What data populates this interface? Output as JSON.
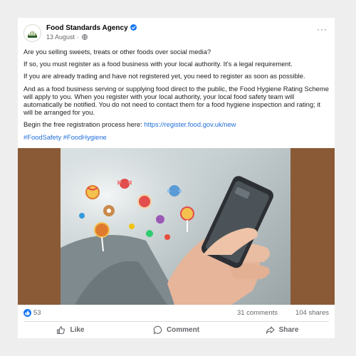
{
  "post": {
    "author": "Food Standards Agency",
    "date": "13 August",
    "separator": "·",
    "more": "···",
    "paragraphs": [
      "Are you selling sweets, treats or other foods over social media?",
      "If so, you must register as a food business with your local authority. It's a legal requirement.",
      "If you are already trading and have not registered yet, you need to register as soon as possible.",
      "And as a food business serving or supplying food direct to the public, the Food Hygiene Rating Scheme will apply to you. When you register with your local authority, your local food safety team will automatically be notified. You do not need to contact them for a food hygiene inspection and rating; it will be arranged for you."
    ],
    "registration_lead": "Begin the free registration process here: ",
    "registration_link": "https://register.food.gov.uk/new",
    "hashtags": "#FoodSafety #FoodHygiene"
  },
  "stats": {
    "reactions": "53",
    "comments": "31 comments",
    "shares": "104 shares"
  },
  "actions": {
    "like": "Like",
    "comment": "Comment",
    "share": "Share"
  },
  "colors": {
    "accent": "#1877f2",
    "link": "#216fdb",
    "media_background": "#8a5a36"
  },
  "icons": [
    "verified-badge-icon",
    "globe-icon",
    "more-options-icon",
    "like-reaction-icon",
    "thumbs-up-icon",
    "comment-bubble-icon",
    "share-arrow-icon"
  ]
}
